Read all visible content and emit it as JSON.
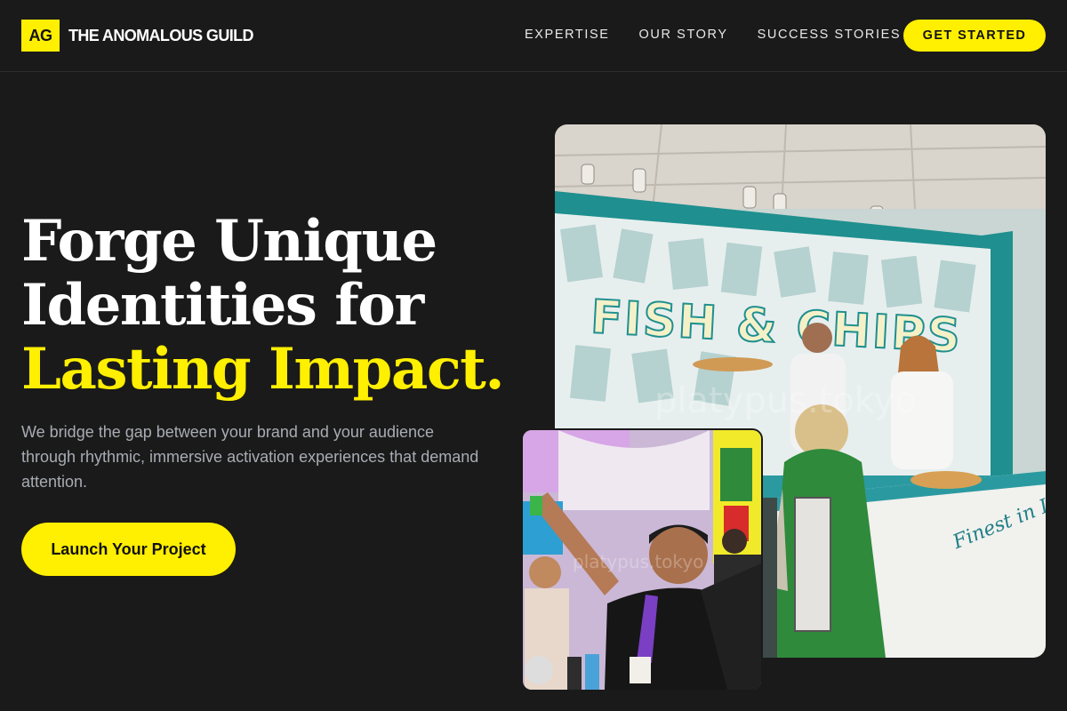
{
  "header": {
    "logo_badge": "AG",
    "logo_text": "THE ANOMALOUS GUILD",
    "nav": [
      "EXPERTISE",
      "OUR STORY",
      "SUCCESS STORIES"
    ],
    "cta": "GET STARTED"
  },
  "hero": {
    "headline_line1": "Forge Unique",
    "headline_line2": "Identities for",
    "headline_accent": "Lasting Impact.",
    "subtitle": "We bridge the gap between your brand and your audience through rhythmic, immersive activation experiences that demand attention.",
    "cta": "Launch Your Project"
  },
  "photos": {
    "main_sign": "FISH & CHIPS",
    "main_counter_script": "Finest in London",
    "watermark": "platypus.tokyo"
  },
  "colors": {
    "background": "#1a1a1a",
    "accent": "#ffef00",
    "muted_text": "#a8acb3"
  }
}
